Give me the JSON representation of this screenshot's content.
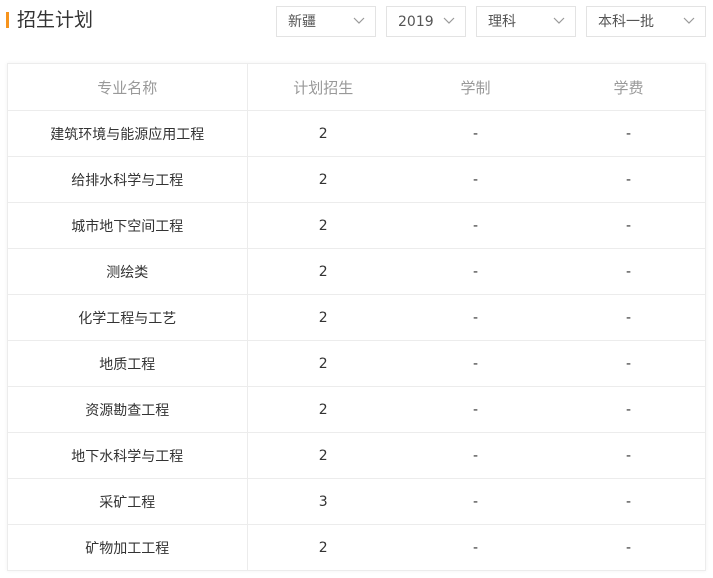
{
  "header": {
    "title": "招生计划"
  },
  "filters": {
    "province": "新疆",
    "year": "2019",
    "subject_type": "理科",
    "batch": "本科一批"
  },
  "table": {
    "columns": [
      "专业名称",
      "计划招生",
      "学制",
      "学费"
    ],
    "rows": [
      [
        "建筑环境与能源应用工程",
        "2",
        "-",
        "-"
      ],
      [
        "给排水科学与工程",
        "2",
        "-",
        "-"
      ],
      [
        "城市地下空间工程",
        "2",
        "-",
        "-"
      ],
      [
        "测绘类",
        "2",
        "-",
        "-"
      ],
      [
        "化学工程与工艺",
        "2",
        "-",
        "-"
      ],
      [
        "地质工程",
        "2",
        "-",
        "-"
      ],
      [
        "资源勘查工程",
        "2",
        "-",
        "-"
      ],
      [
        "地下水科学与工程",
        "2",
        "-",
        "-"
      ],
      [
        "采矿工程",
        "3",
        "-",
        "-"
      ],
      [
        "矿物加工工程",
        "2",
        "-",
        "-"
      ]
    ]
  },
  "colors": {
    "accent": "#f7941d",
    "header_text": "#999999",
    "border": "#ececec"
  },
  "icons": {
    "dropdown": "chevron-down-icon"
  }
}
